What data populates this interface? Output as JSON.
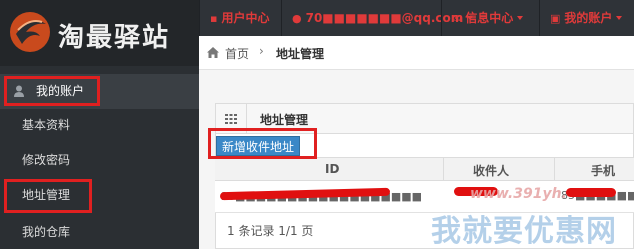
{
  "brand": {
    "logo_text": "淘最驿站"
  },
  "sidebar": {
    "items": [
      {
        "label": "我的账户"
      },
      {
        "label": "基本资料"
      },
      {
        "label": "修改密码"
      },
      {
        "label": "地址管理"
      },
      {
        "label": "我的仓库"
      }
    ]
  },
  "topnav": {
    "user_center": "用户中心",
    "email": "70■■■■■■■@qq.com",
    "messages": "信息中心",
    "my_account": "我的账户"
  },
  "breadcrumb": {
    "home": "首页",
    "separator": "›",
    "current": "地址管理"
  },
  "panel": {
    "title": "地址管理",
    "add_button": "新增收件地址",
    "columns": [
      "ID",
      "收件人",
      "手机"
    ],
    "rows": [
      {
        "id": "20■■■■■■■■■■■■■■■■■■",
        "receiver": "",
        "phone": "85■■■■■■■"
      }
    ],
    "footer": "1 条记录 1/1 页"
  },
  "watermark": {
    "url": "www.391yh.",
    "text": "我就要优惠网"
  },
  "colors": {
    "accent": "#e03a3a",
    "button": "#3a88c7",
    "sidebar": "#2b2f33",
    "highlight_box": "#e02020"
  },
  "icons": [
    "logo-icon",
    "user-icon",
    "envelope-icon",
    "home-icon",
    "grid-icon",
    "caret-down-icon"
  ]
}
